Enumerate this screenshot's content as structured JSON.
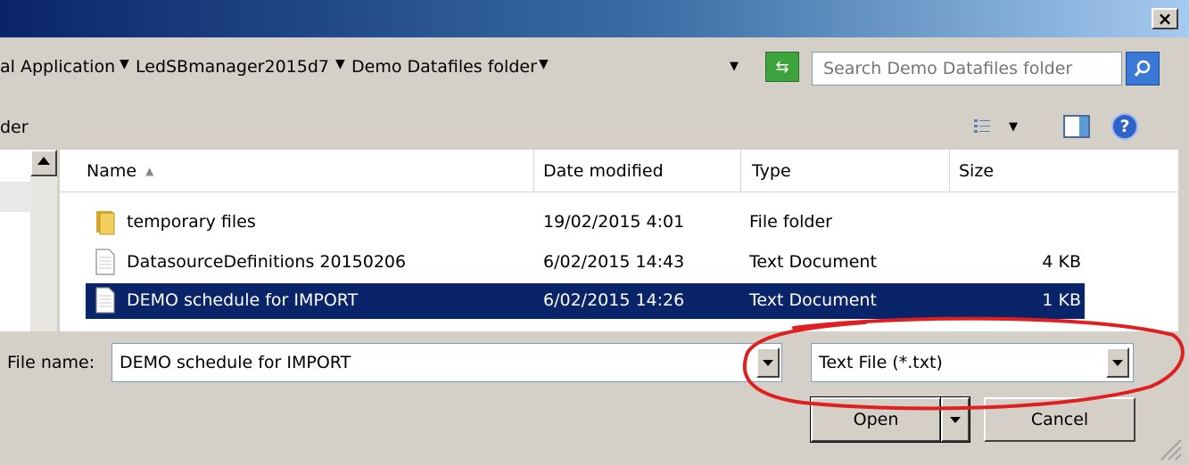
{
  "window": {
    "close_label": "×"
  },
  "address_bar": {
    "breadcrumbs": [
      "al Application",
      "LedSBmanager2015d7",
      "Demo Datafiles folder"
    ],
    "search_placeholder": "Search Demo Datafiles folder"
  },
  "toolbar": {
    "label": "der"
  },
  "file_list": {
    "columns": [
      "Name",
      "Date modified",
      "Type",
      "Size"
    ],
    "rows": [
      {
        "name": "temporary files",
        "date": "19/02/2015 4:01",
        "type": "File folder",
        "size": "",
        "icon": "folder-icon",
        "selected": false
      },
      {
        "name": "DatasourceDefinitions 20150206",
        "date": "6/02/2015 14:43",
        "type": "Text Document",
        "size": "4 KB",
        "icon": "text-file-icon",
        "selected": false
      },
      {
        "name": "DEMO schedule for IMPORT",
        "date": "6/02/2015 14:26",
        "type": "Text Document",
        "size": "1 KB",
        "icon": "text-file-icon",
        "selected": true
      }
    ]
  },
  "bottom": {
    "filename_label": "File name:",
    "filename_value": "DEMO schedule for IMPORT",
    "filetype_value": "Text File (*.txt)",
    "open_label": "Open",
    "cancel_label": "Cancel"
  },
  "colors": {
    "selection": "#0a246a",
    "annotation": "#e02020",
    "dialog_bg": "#d4d0c8"
  }
}
